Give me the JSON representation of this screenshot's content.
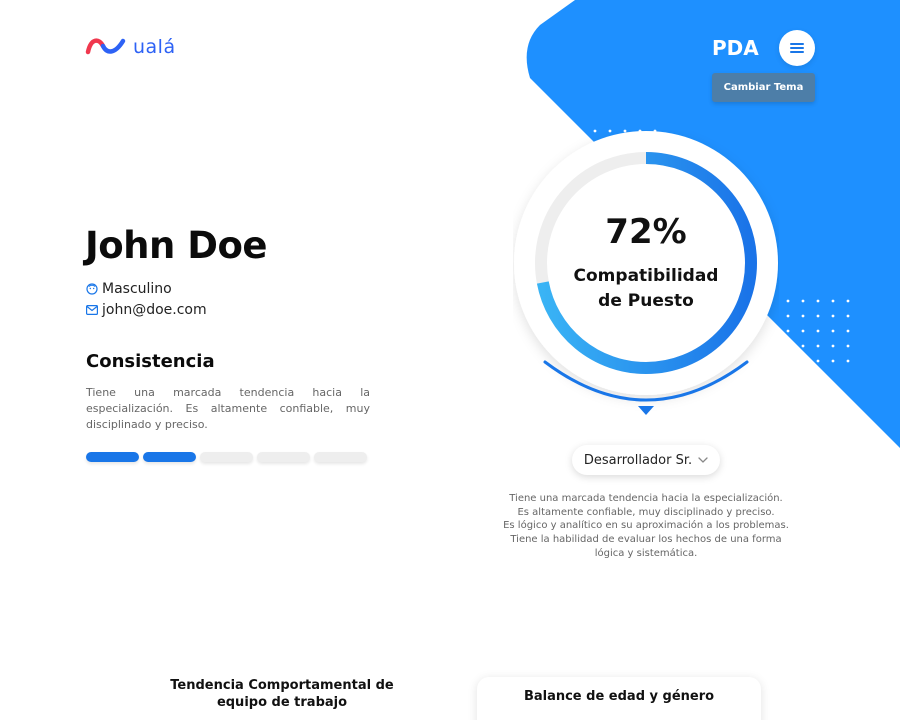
{
  "brand": {
    "name": "ualá",
    "app": "PDA"
  },
  "header": {
    "theme_button": "Cambiar Tema"
  },
  "profile": {
    "name": "John Doe",
    "gender": "Masculino",
    "email": "john@doe.com"
  },
  "trait": {
    "title": "Consistencia",
    "description": "Tiene una marcada tendencia hacia la especialización. Es altamente confiable, muy disciplinado y preciso.",
    "level": 2,
    "max_level": 5
  },
  "compatibility": {
    "value_text": "72%",
    "value": 0.72,
    "label_line1": "Compatibilidad",
    "label_line2": "de Puesto"
  },
  "role": {
    "selected": "Desarrollador Sr.",
    "description_lines": [
      "Tiene una marcada tendencia hacia la especialización.",
      "Es altamente confiable, muy disciplinado y preciso.",
      "Es lógico y analítico en su aproximación a los problemas.",
      "Tiene la habilidad de evaluar los hechos de una forma",
      "lógica y sistemática."
    ]
  },
  "sections": {
    "team_trend_line1": "Tendencia Comportamental de",
    "team_trend_line2": "equipo de trabajo",
    "balance_title": "Balance de edad y género"
  },
  "colors": {
    "primary": "#1976e8",
    "accent": "#2d8cff",
    "theme_button": "#4d7ea8",
    "brand_red": "#f0384e",
    "brand_blue": "#2d62f5"
  }
}
